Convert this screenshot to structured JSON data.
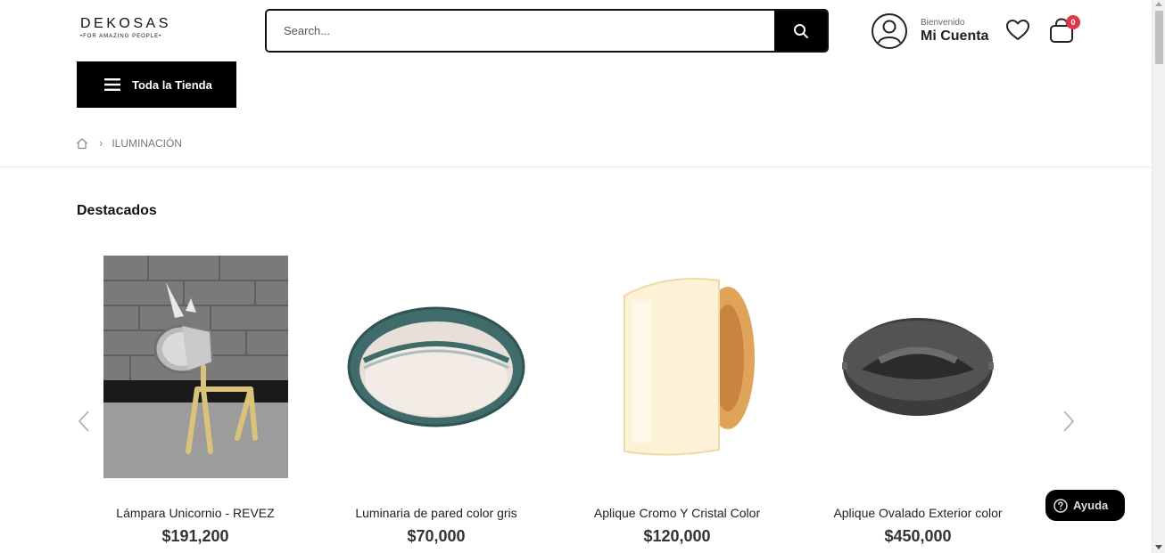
{
  "header": {
    "logo_main": "DEKOSAS",
    "logo_tagline": "•FOR AMAZING PEOPLE•",
    "search_placeholder": "Search...",
    "account_greeting": "Bienvenido",
    "account_label": "Mi Cuenta",
    "cart_count": "0",
    "store_button_label": "Toda la Tienda"
  },
  "breadcrumb": {
    "current": "ILUMINACIÓN"
  },
  "section": {
    "title": "Destacados"
  },
  "products": [
    {
      "name": "Lámpara Unicornio - REVEZ",
      "price": "$191,200"
    },
    {
      "name": "Luminaria de pared color gris",
      "price": "$70,000"
    },
    {
      "name": "Aplique Cromo Y Cristal Color",
      "price": "$120,000"
    },
    {
      "name": "Aplique Ovalado Exterior color",
      "price": "$450,000"
    }
  ],
  "help": {
    "label": "Ayuda"
  },
  "colors": {
    "accent": "#000000",
    "badge": "#e0364b"
  }
}
